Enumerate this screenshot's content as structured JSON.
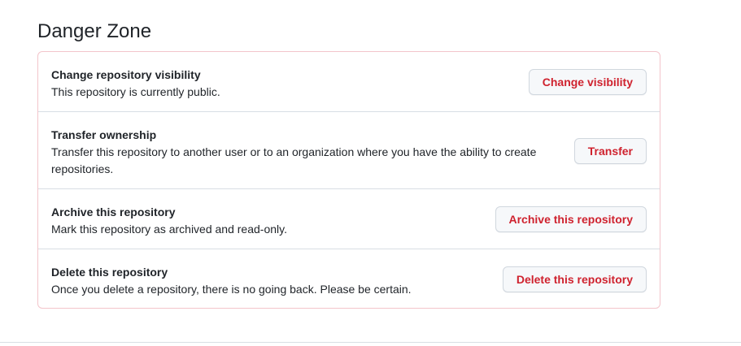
{
  "section": {
    "title": "Danger Zone"
  },
  "rows": [
    {
      "title": "Change repository visibility",
      "description": "This repository is currently public.",
      "button": "Change visibility"
    },
    {
      "title": "Transfer ownership",
      "description": "Transfer this repository to another user or to an organization where you have the ability to create repositories.",
      "button": "Transfer"
    },
    {
      "title": "Archive this repository",
      "description": "Mark this repository as archived and read-only.",
      "button": "Archive this repository"
    },
    {
      "title": "Delete this repository",
      "description": "Once you delete a repository, there is no going back. Please be certain.",
      "button": "Delete this repository"
    }
  ],
  "colors": {
    "danger": "#cf222e",
    "danger_border": "#f3c5cb",
    "button_bg": "#f6f8fa"
  }
}
